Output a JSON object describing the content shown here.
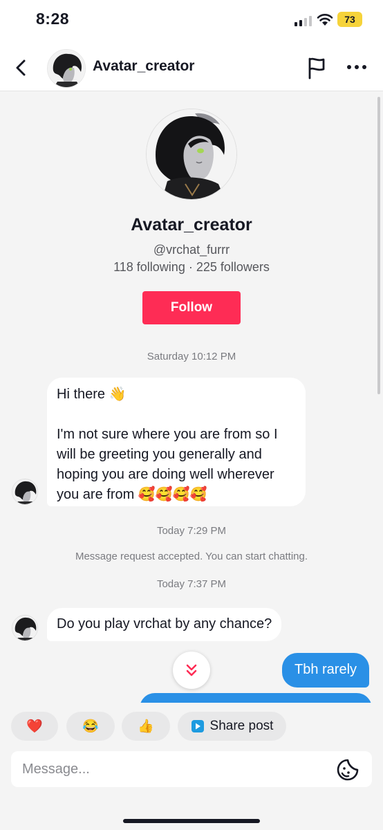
{
  "status_bar": {
    "time": "8:28",
    "battery": "73",
    "battery_color": "#f6d33a"
  },
  "header": {
    "title": "Avatar_creator",
    "back_icon": "chevron-left-icon",
    "flag_icon": "flag-icon",
    "more_icon": "more-horizontal-icon"
  },
  "profile": {
    "name": "Avatar_creator",
    "handle": "@vrchat_furrr",
    "stats": "118 following · 225 followers",
    "follow_label": "Follow",
    "follow_color": "#fe2c55"
  },
  "chat": {
    "timestamp_1": "Saturday 10:12 PM",
    "message_1_line1": "Hi there 👋",
    "message_1_line2": "I'm not sure where you are from so I will be greeting you generally and hoping you are doing well wherever you are from 🥰🥰🥰🥰",
    "timestamp_2": "Today 7:29 PM",
    "system_message": "Message request accepted. You can start chatting.",
    "timestamp_3": "Today 7:37 PM",
    "message_2": "Do you play vrchat by any chance?",
    "message_out_1": "Tbh rarely",
    "outgoing_color": "#2a90e6"
  },
  "quick_replies": {
    "heart": "❤️",
    "laugh": "😂",
    "thumbs_up": "👍",
    "share_post": "Share post"
  },
  "composer": {
    "placeholder": "Message..."
  }
}
